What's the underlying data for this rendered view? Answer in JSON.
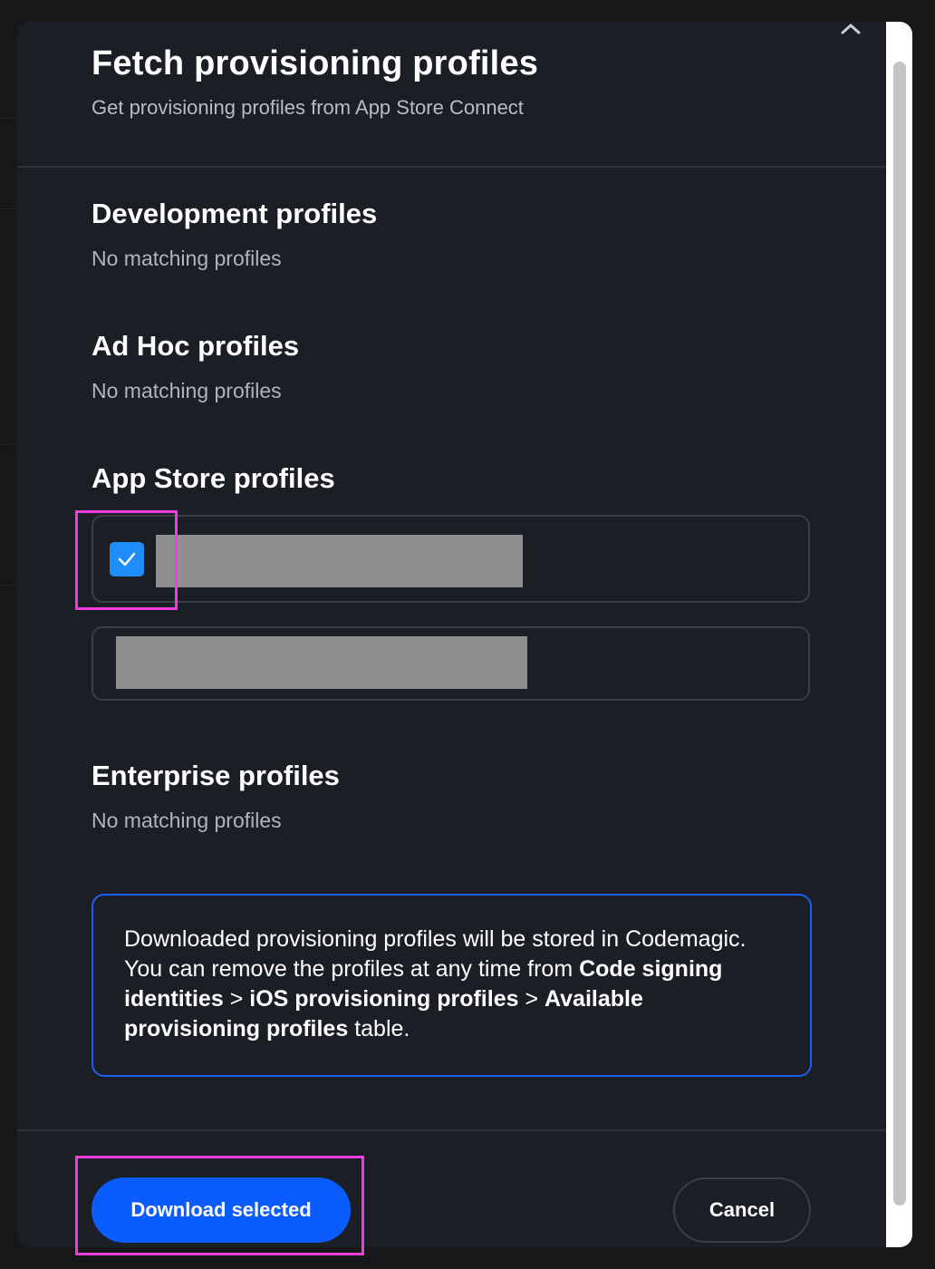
{
  "dialog": {
    "title": "Fetch provisioning profiles",
    "subtitle": "Get provisioning profiles from App Store Connect"
  },
  "sections": {
    "development": {
      "title": "Development profiles",
      "empty_text": "No matching profiles"
    },
    "adhoc": {
      "title": "Ad Hoc profiles",
      "empty_text": "No matching profiles"
    },
    "appstore": {
      "title": "App Store profiles",
      "profiles": [
        {
          "checked": true
        },
        {
          "checked": false
        }
      ]
    },
    "enterprise": {
      "title": "Enterprise profiles",
      "empty_text": "No matching profiles"
    }
  },
  "info": {
    "t1": "Downloaded provisioning profiles will be stored in Codemagic. You can remove the profiles at any time from ",
    "b1": "Code signing identities",
    "t2": " > ",
    "b2": "iOS provisioning profiles",
    "t3": " > ",
    "b3": "Available provisioning profiles",
    "t4": " table."
  },
  "actions": {
    "download_label": "Download selected",
    "cancel_label": "Cancel"
  },
  "colors": {
    "accent": "#0b5cff",
    "checkbox": "#1e8df7",
    "info_border": "#1e5ff0",
    "highlight": "#ef3cdd"
  }
}
